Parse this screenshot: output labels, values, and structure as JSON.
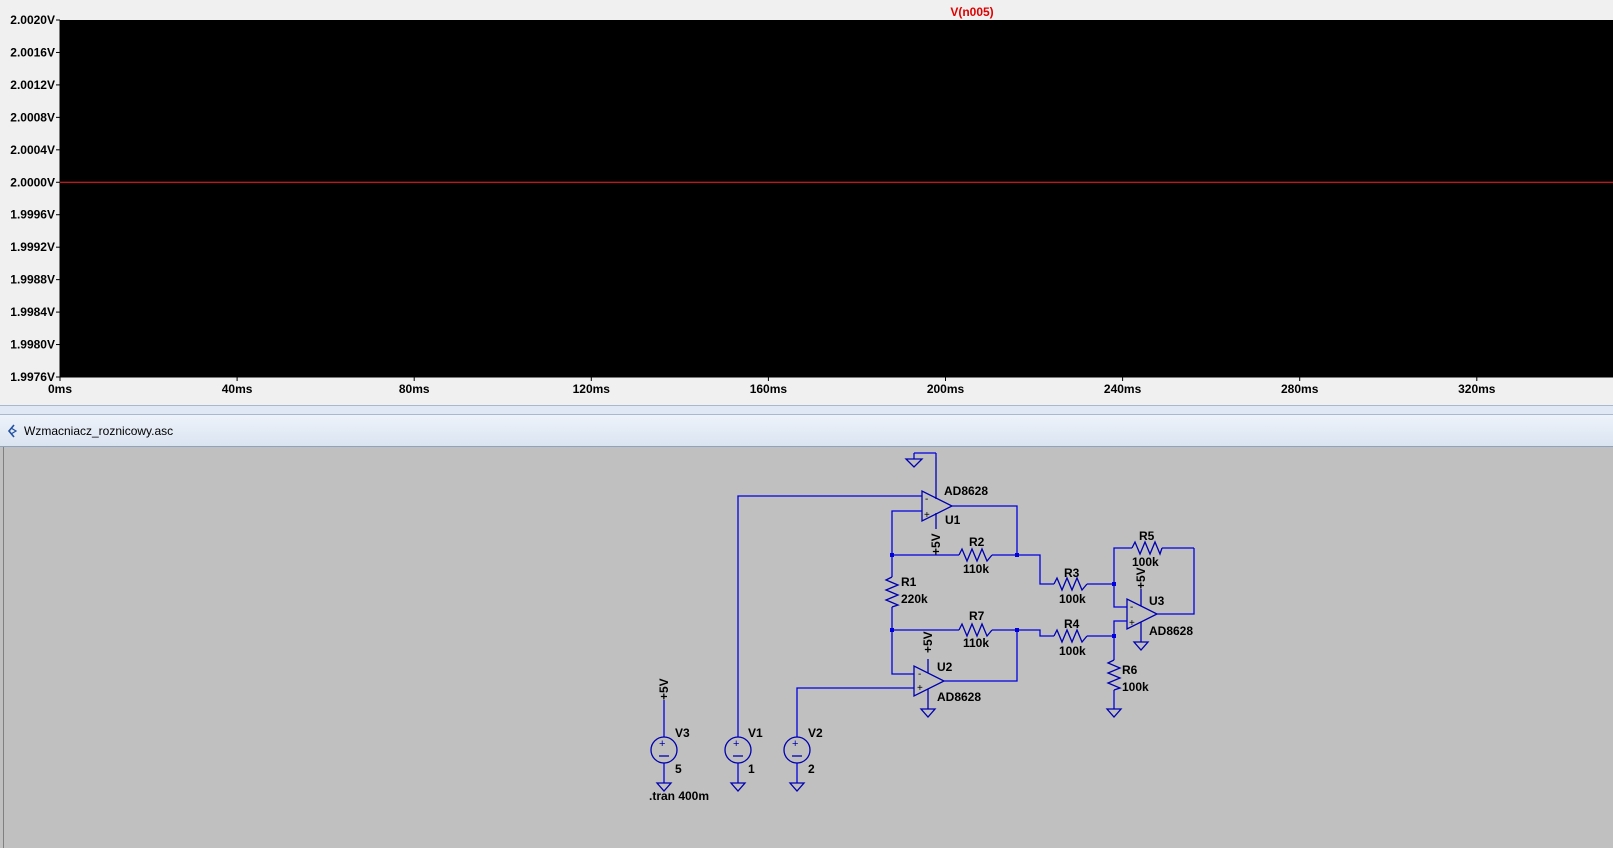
{
  "waveform": {
    "trace_label": "V(n005)",
    "trace_color": "#ff2020",
    "y_ticks": [
      "2.0020V",
      "2.0016V",
      "2.0012V",
      "2.0008V",
      "2.0004V",
      "2.0000V",
      "1.9996V",
      "1.9992V",
      "1.9988V",
      "1.9984V",
      "1.9980V",
      "1.9976V"
    ],
    "x_ticks": [
      "0ms",
      "40ms",
      "80ms",
      "120ms",
      "160ms",
      "200ms",
      "240ms",
      "280ms",
      "320ms"
    ],
    "background": "#000000"
  },
  "chart_data": {
    "type": "line",
    "x": [
      0,
      355
    ],
    "series": [
      {
        "name": "V(n005)",
        "values": [
          2.0,
          2.0
        ]
      }
    ],
    "ylim": [
      1.9976,
      2.002
    ],
    "xlim": [
      0,
      355
    ]
  },
  "schematic_tab": {
    "title": "Wzmacniacz_roznicowy.asc"
  },
  "schematic": {
    "wire_color": "#0000e0",
    "labels": {
      "u1_model": "AD8628",
      "u1_name": "U1",
      "u1_supply": "+5V",
      "u2_model": "AD8628",
      "u2_name": "U2",
      "u2_supply": "+5V",
      "u3_model": "AD8628",
      "u3_name": "U3",
      "u3_supply": "+5V",
      "r1_name": "R1",
      "r1_value": "220k",
      "r2_name": "R2",
      "r2_value": "110k",
      "r3_name": "R3",
      "r3_value": "100k",
      "r4_name": "R4",
      "r4_value": "100k",
      "r5_name": "R5",
      "r5_value": "100k",
      "r6_name": "R6",
      "r6_value": "100k",
      "r7_name": "R7",
      "r7_value": "110k",
      "v1_name": "V1",
      "v1_value": "1",
      "v2_name": "V2",
      "v2_value": "2",
      "v3_name": "V3",
      "v3_value": "5",
      "v3_supply": "+5V",
      "directive": ".tran 400m"
    }
  }
}
